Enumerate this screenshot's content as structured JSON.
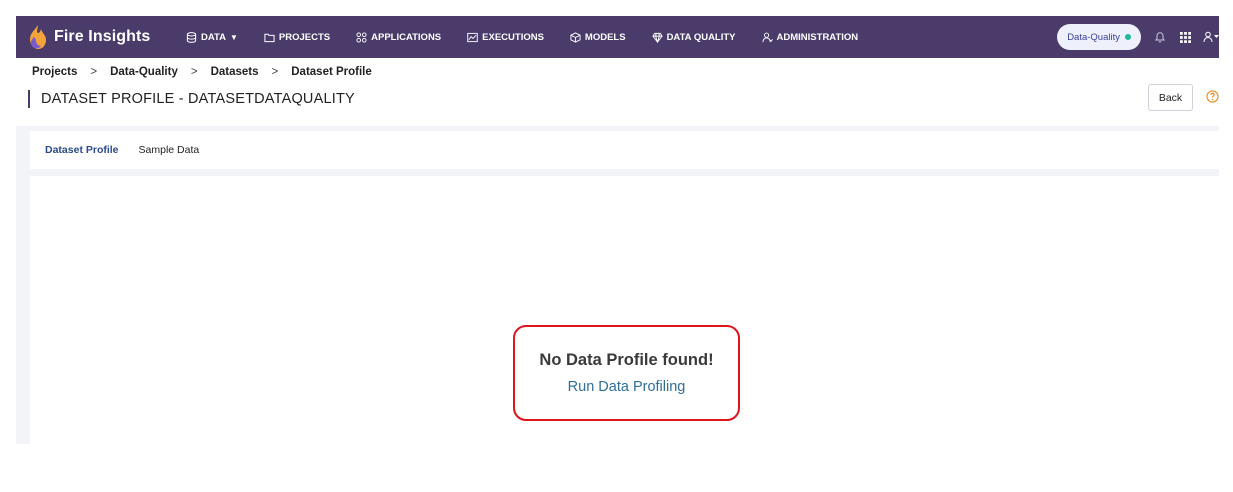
{
  "brand": {
    "name": "Fire Insights"
  },
  "nav": [
    {
      "label": "DATA",
      "icon": "database-icon",
      "dropdown": true
    },
    {
      "label": "PROJECTS",
      "icon": "folder-icon"
    },
    {
      "label": "APPLICATIONS",
      "icon": "grid-icon"
    },
    {
      "label": "EXECUTIONS",
      "icon": "chart-icon"
    },
    {
      "label": "MODELS",
      "icon": "cube-icon"
    },
    {
      "label": "DATA QUALITY",
      "icon": "diamond-icon"
    },
    {
      "label": "ADMINISTRATION",
      "icon": "users-icon"
    }
  ],
  "navRight": {
    "project": "Data-Quality",
    "statusColor": "#1fb89a"
  },
  "breadcrumb": [
    "Projects",
    "Data-Quality",
    "Datasets",
    "Dataset Profile"
  ],
  "breadcrumbSeparator": ">",
  "page": {
    "title": "DATASET PROFILE - DATASETDATAQUALITY",
    "back": "Back"
  },
  "tabs": [
    {
      "label": "Dataset Profile",
      "active": true
    },
    {
      "label": "Sample Data",
      "active": false
    }
  ],
  "empty": {
    "title": "No Data Profile found!",
    "action": "Run Data Profiling"
  },
  "colors": {
    "navbar": "#4a3b6b",
    "highlight": "#e0141b",
    "link": "#2f6f9a",
    "help": "#f08a24"
  }
}
